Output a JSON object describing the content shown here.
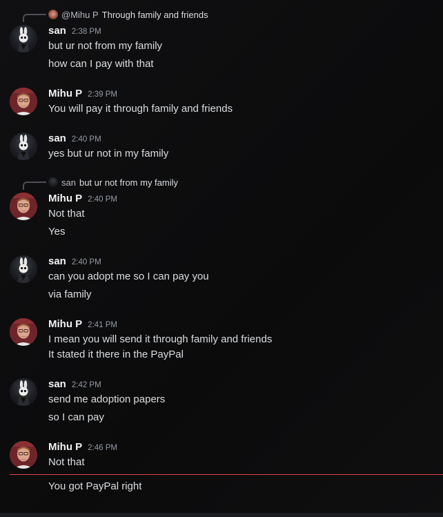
{
  "messages": [
    {
      "reply": {
        "name": "@Mihu P",
        "text": "Through family and friends"
      },
      "author": "san",
      "time": "2:38 PM",
      "lines": [
        "but ur not from my family",
        "how can I pay with that"
      ]
    },
    {
      "author": "Mihu P",
      "time": "2:39 PM",
      "lines": [
        "You will pay it through family and friends"
      ]
    },
    {
      "author": "san",
      "time": "2:40 PM",
      "lines": [
        "yes but ur not in my family"
      ]
    },
    {
      "reply": {
        "name": "san",
        "text": "but ur not from my family"
      },
      "author": "Mihu P",
      "time": "2:40 PM",
      "lines": [
        "Not that",
        "Yes"
      ]
    },
    {
      "author": "san",
      "time": "2:40 PM",
      "lines": [
        "can you adopt me so I can pay you",
        "via family"
      ]
    },
    {
      "author": "Mihu P",
      "time": "2:41 PM",
      "lines": [
        "I mean you will send it through family and friends",
        "It stated it there in the PayPal"
      ]
    },
    {
      "author": "san",
      "time": "2:42 PM",
      "lines": [
        "send me adoption papers",
        "so I can pay"
      ]
    },
    {
      "author": "Mihu P",
      "time": "2:46 PM",
      "lines": [
        "Not that",
        "You got PayPal right"
      ]
    }
  ],
  "colors": {
    "background": "#0d0d0e",
    "new_messages_divider": "#e0434a",
    "username": "#f2f3f5",
    "timestamp": "#949ba4",
    "message_text": "#dbdee1"
  }
}
